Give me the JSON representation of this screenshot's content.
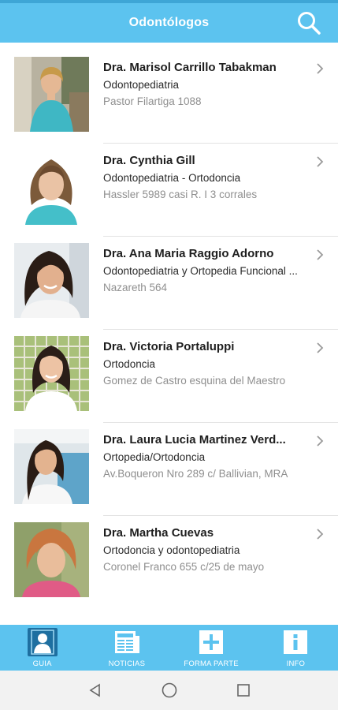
{
  "app_bar": {
    "title": "Odontólogos"
  },
  "doctors": [
    {
      "name": "Dra. Marisol Carrillo Tabakman",
      "specialty": "Odontopediatria",
      "address": "Pastor Filartiga 1088"
    },
    {
      "name": "Dra. Cynthia Gill",
      "specialty": "Odontopediatria - Ortodoncia",
      "address": "Hassler 5989 casi R. I 3 corrales"
    },
    {
      "name": "Dra. Ana Maria Raggio Adorno",
      "specialty": "Odontopediatria y Ortopedia Funcional ...",
      "address": "Nazareth 564"
    },
    {
      "name": "Dra. Victoria Portaluppi",
      "specialty": "Ortodoncia",
      "address": "Gomez de Castro esquina del Maestro"
    },
    {
      "name": "Dra. Laura Lucia Martinez Verd...",
      "specialty": "Ortopedia/Ortodoncia",
      "address": "Av.Boqueron Nro 289 c/ Ballivian, MRA"
    },
    {
      "name": "Dra. Martha Cuevas",
      "specialty": "Ortodoncia y odontopediatria",
      "address": "Coronel Franco 655 c/25 de mayo"
    }
  ],
  "bottom_nav": [
    {
      "label": "GUIA",
      "icon": "person-icon",
      "active": true
    },
    {
      "label": "NOTICIAS",
      "icon": "newspaper-icon",
      "active": false
    },
    {
      "label": "FORMA PARTE",
      "icon": "plus-icon",
      "active": false
    },
    {
      "label": "INFO",
      "icon": "info-icon",
      "active": false
    }
  ],
  "colors": {
    "primary": "#5cc3ef",
    "active_tab": "#1e6fa0",
    "name_text": "#1e1e1e",
    "address_text": "#8f8f8f"
  }
}
